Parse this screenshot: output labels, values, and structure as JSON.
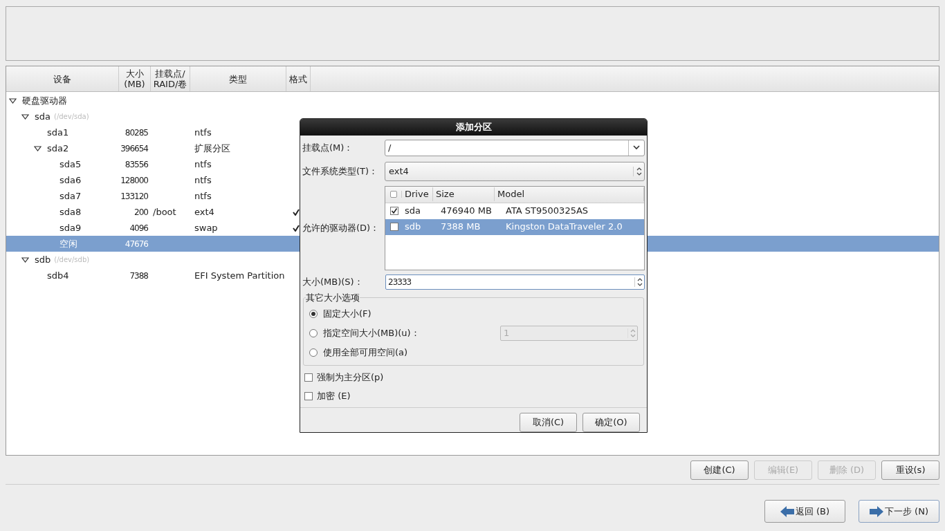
{
  "table": {
    "columns": [
      "设备",
      "大小\n(MB)",
      "挂载点/\nRAID/卷",
      "类型",
      "格式"
    ],
    "tree": [
      {
        "name": "硬盘驱动器",
        "expanded": true,
        "selected": false,
        "children": [
          {
            "name": "sda",
            "path": "(/dev/sda)",
            "expanded": true,
            "selected": false,
            "children": [
              {
                "name": "sda1",
                "size": "80285",
                "type": "ntfs",
                "format": false,
                "selected": false
              },
              {
                "name": "sda2",
                "size": "396654",
                "type": "扩展分区",
                "format": false,
                "expanded": true,
                "selected": false,
                "children": [
                  {
                    "name": "sda5",
                    "size": "83556",
                    "type": "ntfs",
                    "format": false,
                    "selected": false
                  },
                  {
                    "name": "sda6",
                    "size": "128000",
                    "type": "ntfs",
                    "format": false,
                    "selected": false
                  },
                  {
                    "name": "sda7",
                    "size": "133120",
                    "type": "ntfs",
                    "format": false,
                    "selected": false
                  },
                  {
                    "name": "sda8",
                    "size": "200",
                    "mount": "/boot",
                    "type": "ext4",
                    "format": true,
                    "selected": false
                  },
                  {
                    "name": "sda9",
                    "size": "4096",
                    "type": "swap",
                    "format": true,
                    "selected": false
                  },
                  {
                    "name": "空闲",
                    "size": "47676",
                    "format": false,
                    "selected": true
                  }
                ]
              }
            ]
          },
          {
            "name": "sdb",
            "path": "(/dev/sdb)",
            "expanded": true,
            "selected": false,
            "children": [
              {
                "name": "sdb4",
                "size": "7388",
                "type": "EFI System Partition",
                "format": false,
                "selected": false
              }
            ]
          }
        ]
      }
    ]
  },
  "actions": [
    {
      "label": "创建(C)",
      "disabled": false
    },
    {
      "label": "编辑(E)",
      "disabled": true
    },
    {
      "label": "删除 (D)",
      "disabled": true
    },
    {
      "label": "重设(s)",
      "disabled": false
    }
  ],
  "nav": [
    {
      "label": "返回 (B)",
      "kind": "back"
    },
    {
      "label": "下一步 (N)",
      "kind": "next"
    }
  ],
  "dialog": {
    "title": "添加分区",
    "mount_label": "挂载点(M)：",
    "mount_value": "/",
    "fs_label": "文件系统类型(T)：",
    "fs_value": "ext4",
    "drives_label": "允许的驱动器(D)：",
    "drive_columns": [
      "Drive",
      "Size",
      "Model"
    ],
    "all_checked": false,
    "drives": [
      {
        "drive": "sda",
        "size": "476940 MB",
        "model": "ATA ST9500325AS",
        "checked": true,
        "selected": false
      },
      {
        "drive": "sdb",
        "size": "7388 MB",
        "model": "Kingston DataTraveler 2.0",
        "checked": false,
        "selected": true
      }
    ],
    "size_label": "大小(MB)(S)：",
    "size_value": "23333",
    "group_title": "其它大小选项",
    "options": [
      {
        "label": "固定大小(F)",
        "selected": true
      },
      {
        "label": "指定空间大小(MB)(u)：",
        "selected": false,
        "value": "1"
      },
      {
        "label": "使用全部可用空间(a)",
        "selected": false
      }
    ],
    "checks": [
      {
        "label": "强制为主分区(p)",
        "checked": false
      },
      {
        "label": "加密 (E)",
        "checked": false
      }
    ],
    "buttons": [
      "取消(C)",
      "确定(O)"
    ]
  }
}
